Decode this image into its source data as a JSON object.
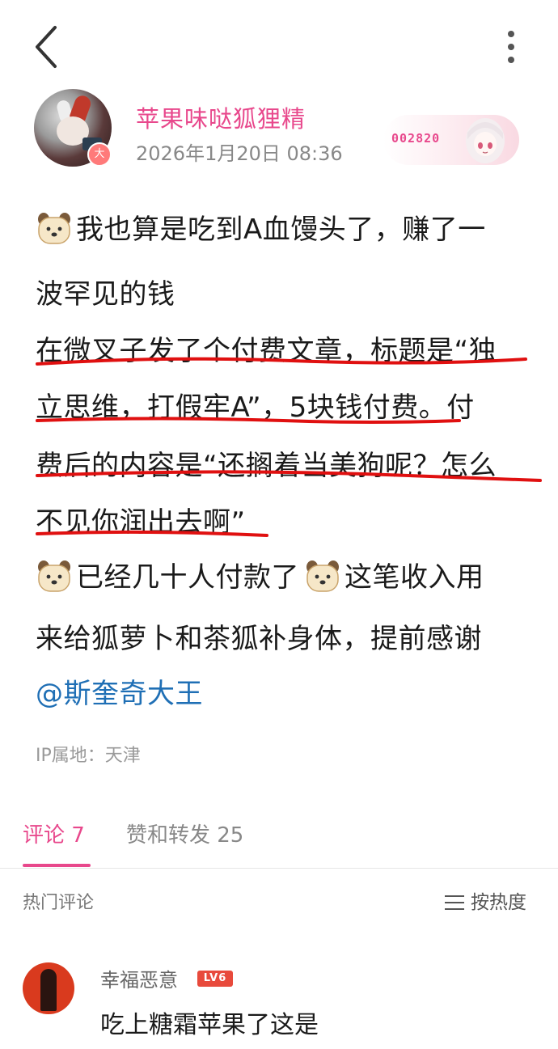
{
  "header": {
    "back_icon": "chevron-left-icon",
    "more_icon": "more-vertical-icon"
  },
  "author": {
    "name": "苹果味哒狐狸精",
    "time": "2026年1月20日 08:36",
    "level_badge": "大",
    "fan_badge_number": "002820"
  },
  "post": {
    "lines": [
      "我也算是吃到A血馒头了，赚了一",
      "波罕见的钱",
      "在微叉子发了个付费文章，标题是“独",
      "立思维，打假牢A”，5块钱付费。付",
      "费后的内容是“还搁着当美狗呢？怎么",
      "不见你润出去啊”",
      "已经几十人付款了",
      "这笔收入用",
      "来给狐萝卜和茶狐补身体，提前感谢"
    ],
    "mention": "@斯奎奇大王",
    "emoji_icon": "dog-face-emoji-icon",
    "underline_color": "#e01010"
  },
  "ip_location": "IP属地：天津",
  "tabs": {
    "comments": "评论 7",
    "likes_reposts": "赞和转发 25",
    "active_color": "#e8488c"
  },
  "comments_section": {
    "hot_label": "热门评论",
    "sort_label": "按热度",
    "items": [
      {
        "username": "幸福恶意",
        "level": "LV6",
        "text": "吃上糖霜苹果了这是"
      }
    ]
  }
}
